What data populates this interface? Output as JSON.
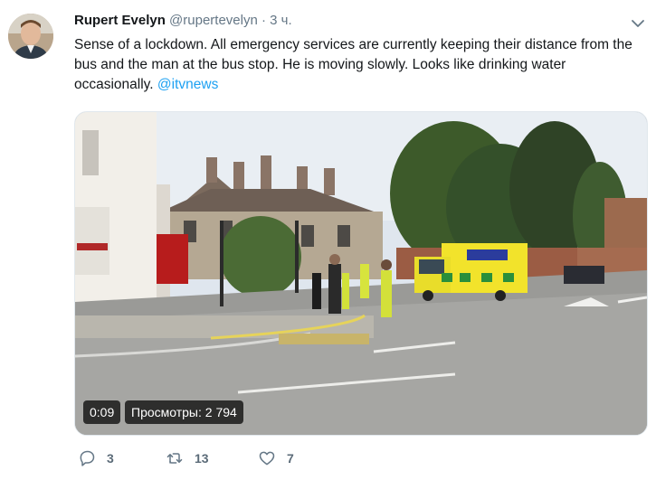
{
  "tweet": {
    "author_name": "Rupert Evelyn",
    "handle": "@rupertevelyn",
    "separator": "·",
    "time": "3 ч.",
    "text": "Sense of a lockdown. All emergency services are currently keeping their distance from the bus and the man at the bus stop. He is moving slowly. Looks like drinking water occasionally.",
    "mention": "@itvnews"
  },
  "video": {
    "duration": "0:09",
    "views": "Просмотры: 2 794"
  },
  "actions": {
    "reply_count": "3",
    "retweet_count": "13",
    "like_count": "7"
  },
  "colors": {
    "link": "#1da1f2",
    "muted": "#657786"
  },
  "icons": {
    "menu": "chevron-down-icon",
    "reply": "reply-icon",
    "retweet": "retweet-icon",
    "like": "heart-icon"
  }
}
